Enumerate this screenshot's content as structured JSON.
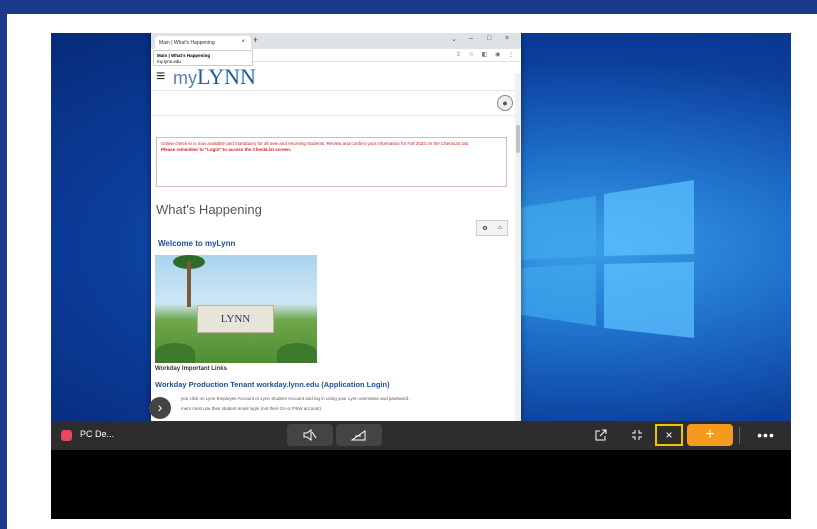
{
  "browser": {
    "tab_title": "Main | What's Happening",
    "tab_close": "×",
    "new_tab": "+",
    "window_controls": [
      "⌄",
      "–",
      "□",
      "×"
    ],
    "tooltip_title": "Main | What's Happening",
    "tooltip_url": "my.lynn.edu",
    "addr_icons": "⇪ ☆ ◧ ◉ ⋮"
  },
  "page": {
    "brand_my": "my",
    "brand_name": "LYNN",
    "alert_line1": "Online check-in is now available and mandatory for all new and returning students. Review and confirm your information for Fall 2023 on the CheckList tab.",
    "alert_line2": "Please remember to \"Login\" to access the CheckList screen.",
    "section_title": "What's Happening",
    "welcome_heading": "Welcome to myLynn",
    "photo_sign": "LYNN",
    "workday_links": "Workday Important Links",
    "workday_production": "Workday Production Tenant workday.lynn.edu (Application Login)",
    "workday_text1": "you click on Lynn Employee Account or Lynn Student Account and log in using your Lynn username and password.",
    "workday_text2": "mers must use their student email login (not their GA or PSW account)."
  },
  "toolbar": {
    "session_title": "PC De...",
    "plus_label": "+",
    "close_label": "×",
    "more_label": "•••"
  },
  "colors": {
    "brand_blue": "#1e5aa8",
    "accent_orange": "#f39a1f",
    "highlight_yellow": "#f2c200",
    "alert_red": "#d02020",
    "record_red": "#e8475f"
  }
}
